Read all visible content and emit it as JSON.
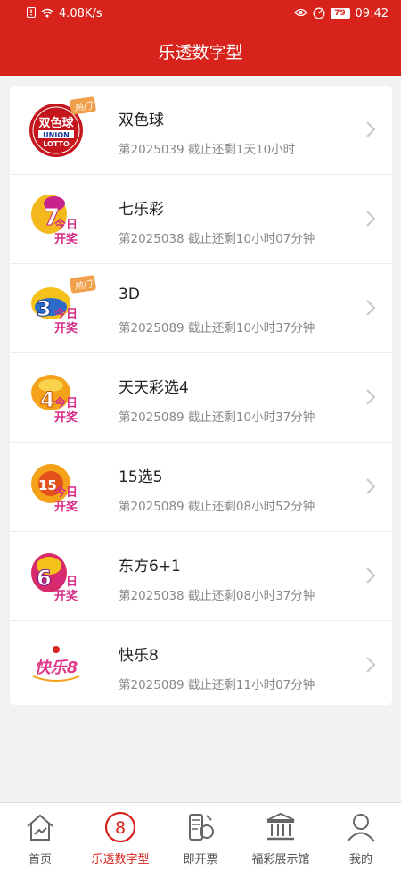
{
  "status_bar": {
    "speed": "4.08K/s",
    "battery": "79",
    "time": "09:42"
  },
  "header": {
    "title": "乐透数字型"
  },
  "lotteries": [
    {
      "name": "双色球",
      "info": "第2025039 截止还剩1天10小时",
      "hot": "热门",
      "logo_text": "双色球"
    },
    {
      "name": "七乐彩",
      "info": "第2025038 截止还剩10小时07分钟",
      "logo_text": "今日开奖"
    },
    {
      "name": "3D",
      "info": "第2025089 截止还剩10小时37分钟",
      "hot": "热门",
      "logo_text": "今日开奖"
    },
    {
      "name": "天天彩选4",
      "info": "第2025089 截止还剩10小时37分钟",
      "logo_text": "今日开奖"
    },
    {
      "name": "15选5",
      "info": "第2025089 截止还剩08小时52分钟",
      "logo_text": "今日开奖"
    },
    {
      "name": "东方6+1",
      "info": "第2025038 截止还剩08小时37分钟",
      "logo_text": "今日开奖"
    },
    {
      "name": "快乐8",
      "info": "第2025089 截止还剩11小时07分钟",
      "logo_text": "快乐8"
    }
  ],
  "tabs": [
    {
      "label": "首页",
      "icon": "home-icon"
    },
    {
      "label": "乐透数字型",
      "icon": "lotto-8-icon",
      "active": true
    },
    {
      "label": "即开票",
      "icon": "instant-ticket-icon"
    },
    {
      "label": "福彩展示馆",
      "icon": "museum-icon"
    },
    {
      "label": "我的",
      "icon": "user-icon"
    }
  ],
  "colors": {
    "primary": "#d8231c",
    "hot_badge": "#f0a04a"
  }
}
